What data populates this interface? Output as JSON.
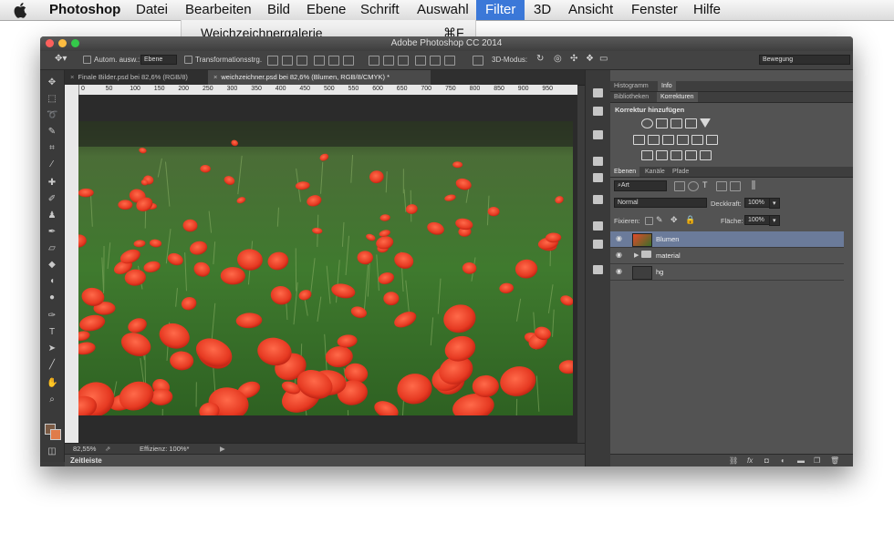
{
  "menubar": {
    "app_name": "Photoshop",
    "items": [
      "Datei",
      "Bearbeiten",
      "Bild",
      "Ebene",
      "Schrift",
      "Auswahl",
      "Filter",
      "3D",
      "Ansicht",
      "Fenster",
      "Hilfe"
    ],
    "active_item": "Filter",
    "dropdown_first_item": "Weichzeichnergalerie",
    "dropdown_shortcut": "⌘F"
  },
  "window": {
    "title": "Adobe Photoshop CC 2014"
  },
  "options_bar": {
    "auto_select_label": "Autom. ausw.:",
    "auto_select_value": "Ebene",
    "transform_label": "Transformationsstrg.",
    "mode_3d_label": "3D-Modus:",
    "workspace_value": "Bewegung"
  },
  "doc_tabs": [
    {
      "label": "Finale Bilder.psd bei 82,6% (RGB/8)"
    },
    {
      "label": "weichzeichner.psd bei 82,6% (Blumen, RGB/8/CMYK) *"
    }
  ],
  "ruler_labels": [
    "0",
    "50",
    "100",
    "150",
    "200",
    "250",
    "300",
    "350",
    "400",
    "450",
    "500",
    "550",
    "600",
    "650",
    "700",
    "750",
    "800",
    "850",
    "900",
    "950"
  ],
  "status": {
    "zoom": "82,55%",
    "efficiency": "Effizienz: 100%*"
  },
  "timeline": {
    "label": "Zeitleiste"
  },
  "panels": {
    "top_tabs": [
      "Histogramm",
      "Info"
    ],
    "top_active": "Info",
    "mid_tabs": [
      "Bibliotheken",
      "Korrekturen"
    ],
    "mid_active": "Korrekturen",
    "adjust_heading": "Korrektur hinzufügen",
    "layer_tabs": [
      "Ebenen",
      "Kanäle",
      "Pfade"
    ],
    "layer_active": "Ebenen",
    "kind_filter": "Art",
    "blend_mode": "Normal",
    "opacity_label": "Deckkraft:",
    "opacity_value": "100%",
    "lock_label": "Fixieren:",
    "fill_label": "Fläche:",
    "fill_value": "100%",
    "layers": [
      {
        "name": "Blumen",
        "selected": true
      },
      {
        "name": "material",
        "selected": false,
        "group": true
      },
      {
        "name": "hg",
        "selected": false
      }
    ],
    "footer_icons": [
      "link-icon",
      "fx-icon",
      "mask-icon",
      "adjustment-icon",
      "folder-icon",
      "new-layer-icon",
      "trash-icon"
    ]
  }
}
